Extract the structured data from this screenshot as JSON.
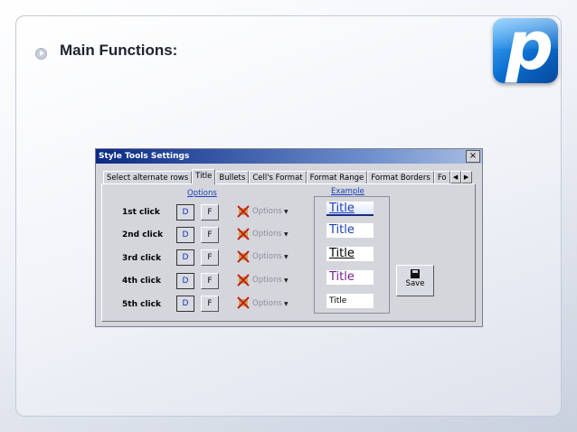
{
  "slide": {
    "heading": "Main Functions:"
  },
  "dialog": {
    "title": "Style Tools Settings",
    "close_label": "×",
    "tabs": [
      "Select alternate rows",
      "Title",
      "Bullets",
      "Cell's Format",
      "Format Range",
      "Format Borders",
      "Fo"
    ],
    "active_tab": "Title",
    "scroll_left": "◀",
    "scroll_right": "▶",
    "options_header": "Options",
    "example_header": "Example",
    "rows": [
      {
        "label": "1st click",
        "d": "D",
        "f": "F",
        "options": "Options",
        "example": "Title"
      },
      {
        "label": "2nd click",
        "d": "D",
        "f": "F",
        "options": "Options",
        "example": "Title"
      },
      {
        "label": "3rd click",
        "d": "D",
        "f": "F",
        "options": "Options",
        "example": "Title"
      },
      {
        "label": "4th click",
        "d": "D",
        "f": "F",
        "options": "Options",
        "example": "Title"
      },
      {
        "label": "5th click",
        "d": "D",
        "f": "F",
        "options": "Options",
        "example": "Title"
      }
    ],
    "save_label": "Save",
    "caret": "▼"
  },
  "colors": {
    "titlebar": "#0a2a86",
    "link": "#1a3fb8",
    "example_purple": "#7a1e90"
  }
}
